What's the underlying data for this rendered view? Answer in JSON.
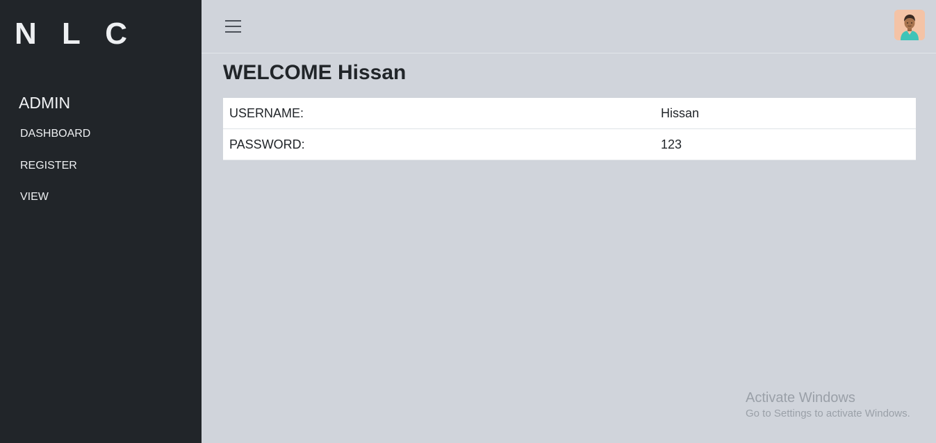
{
  "sidebar": {
    "brand": "N L C",
    "section_title": "ADMIN",
    "items": [
      {
        "label": "DASHBOARD"
      },
      {
        "label": "REGISTER"
      },
      {
        "label": "VIEW"
      }
    ]
  },
  "topbar": {
    "menu_icon": "hamburger-menu-icon",
    "avatar_icon": "user-avatar-icon"
  },
  "main": {
    "title": "WELCOME Hissan",
    "rows": [
      {
        "label": "USERNAME:",
        "value": "Hissan"
      },
      {
        "label": "PASSWORD:",
        "value": "123"
      }
    ]
  },
  "watermark": {
    "line1": "Activate Windows",
    "line2": "Go to Settings to activate Windows."
  },
  "colors": {
    "sidebar_bg": "#212529",
    "content_bg": "#d0d4db",
    "table_bg": "#ffffff"
  }
}
